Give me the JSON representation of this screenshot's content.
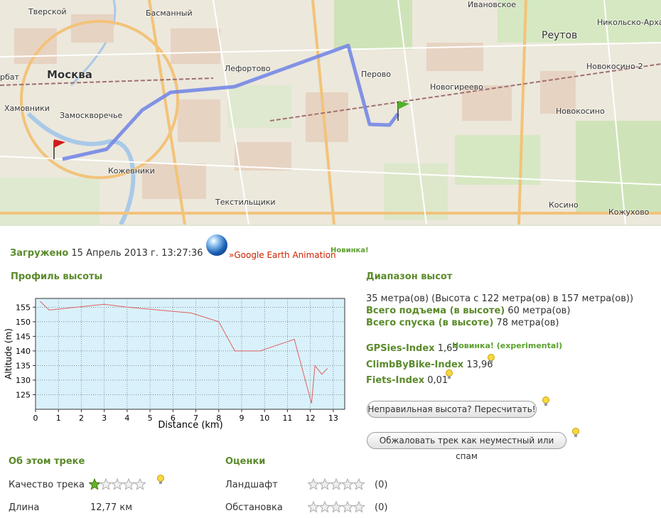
{
  "map": {
    "labels": {
      "tverskoy": "Тверской",
      "basmanny": "Басманный",
      "moskva": "Москва",
      "arbat": "рбат",
      "khamovniki": "Хамовники",
      "zamoskvorechye": "Замоскворечье",
      "kozhevniki": "Кожевники",
      "lefortovo": "Лефортово",
      "tekstilshchiki": "Текстильщики",
      "ivanovskoe": "Ивановское",
      "reutov": "Реутов",
      "nikolsko": "Никольско-Архангел",
      "novokosino2": "Новокосино-2",
      "perovo": "Перово",
      "novogireevo": "Новогиреево",
      "novokosino": "Новокосино",
      "kosino": "Косино",
      "kozhukhovo": "Кожухово"
    }
  },
  "upload": {
    "label": "Загружено",
    "date": "15 Апрель 2013 г. 13:27:36",
    "ge_link": "»Google Earth Animation",
    "new_badge": "Новинка!"
  },
  "profile": {
    "title": "Профиль высоты"
  },
  "chart_data": {
    "type": "line",
    "xlabel": "Distance (km)",
    "ylabel": "Altitude (m)",
    "xlim": [
      0,
      13.5
    ],
    "ylim": [
      120,
      158
    ],
    "xticks": [
      0,
      1,
      2,
      3,
      4,
      5,
      6,
      7,
      8,
      9,
      10,
      11,
      12,
      13
    ],
    "yticks": [
      125,
      130,
      135,
      140,
      145,
      150,
      155
    ],
    "grid": true,
    "color": "#e06060",
    "x": [
      0.2,
      0.6,
      3.0,
      4.0,
      6.8,
      8.0,
      8.7,
      9.8,
      11.3,
      12.05,
      12.2,
      12.5,
      12.75
    ],
    "y": [
      157,
      154,
      156,
      155,
      153,
      150,
      140,
      140,
      144,
      122,
      135,
      132,
      134
    ]
  },
  "range": {
    "title": "Диапазон высот",
    "summary": "35 метра(ов) (Высота с 122 метра(ов) в 157 метра(ов))",
    "ascent_label": "Всего подъема (в высоте)",
    "ascent_value": "60 метра(ов)",
    "descent_label": "Всего спуска (в высоте)",
    "descent_value": "78 метра(ов)",
    "gpsies_label": "GPSies-Index",
    "gpsies_value": "1,65",
    "gpsies_badge": "Новинка! (experimental)",
    "climb_label": "ClimbByBike-Index",
    "climb_value": "13,96",
    "fiets_label": "Fiets-Index",
    "fiets_value": "0,01",
    "recalc_button": "Неправильная высота? Пересчитать!",
    "report_button": "Обжаловать трек как неуместный или спам"
  },
  "about": {
    "title": "Об этом треке",
    "quality_label": "Качество трека",
    "quality_rating": 1,
    "length_label": "Длина",
    "length_value": "12,77 км"
  },
  "ratings": {
    "title": "Оценки",
    "landscape_label": "Ландшафт",
    "landscape_count": "(0)",
    "environment_label": "Обстановка",
    "environment_count": "(0)"
  },
  "colors": {
    "accent_green": "#5a8a2a",
    "route_blue": "#6f82e6",
    "chart_bg": "#d9f1fb",
    "link_red": "#cc2200"
  }
}
